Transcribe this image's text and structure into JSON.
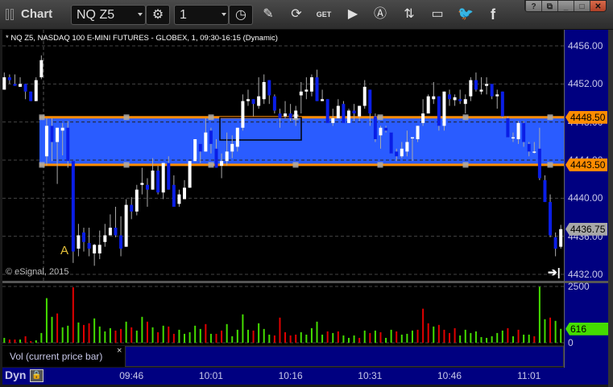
{
  "window": {
    "title": "Chart",
    "symbol": "NQ Z5",
    "interval": "1",
    "buttons": [
      "help",
      "restore-menu",
      "minimize",
      "maximize",
      "close"
    ],
    "toolbar_icons": [
      "settings-icon",
      "clock-icon",
      "pencil-icon",
      "refresh-icon",
      "get-icon",
      "play-icon",
      "alert-icon",
      "link-icon",
      "comment-icon",
      "twitter-icon",
      "facebook-icon"
    ]
  },
  "chart": {
    "info": "* NQ Z5, NASDAQ 100 E-MINI FUTURES - GLOBEX, 1, 09:30-16:15 (Dynamic)",
    "copyright": "© eSignal, 2015",
    "marker_label": "A",
    "price_axis": [
      "4456.00",
      "4452.00",
      "4448.00",
      "4444.00",
      "4440.00",
      "4436.00",
      "4432.00"
    ],
    "tags": [
      {
        "label": "4448.50",
        "value": 4448.5,
        "color": "#ff8c00"
      },
      {
        "label": "4443.50",
        "value": 4443.5,
        "color": "#ff8c00"
      },
      {
        "label": "4436.75",
        "value": 4436.75,
        "color": "#a8a8a8"
      }
    ],
    "zone": {
      "top": 4448.5,
      "bottom": 4443.5,
      "fill": "#2a5cff",
      "border": "#ff8c00"
    },
    "colors": {
      "up": "#ffffff",
      "down": "#0a1ee6",
      "vol_up": "#44dd00",
      "vol_down": "#e00000",
      "axis": "#000080"
    }
  },
  "volume": {
    "axis": [
      "2500",
      "0"
    ],
    "current_label": "616",
    "study_label": "Vol (current price bar)",
    "close": "×"
  },
  "time_axis": {
    "mode": "Dyn",
    "labels": [
      "09:46",
      "10:01",
      "10:16",
      "10:31",
      "10:46",
      "11:01"
    ]
  },
  "chart_data": {
    "type": "candlestick",
    "ylim": [
      4432,
      4456
    ],
    "ohlc": [
      [
        4451.4,
        4453.2,
        4451.4,
        4452.7
      ],
      [
        4452.7,
        4453.0,
        4452.0,
        4452.4
      ],
      [
        4452.0,
        4453.0,
        4451.8,
        4451.8
      ],
      [
        4451.7,
        4452.7,
        4451.7,
        4452.0
      ],
      [
        4452.0,
        4452.0,
        4450.4,
        4451.2
      ],
      [
        4451.2,
        4451.2,
        4450.2,
        4450.2
      ],
      [
        4450.2,
        4452.7,
        4450.2,
        4452.4
      ],
      [
        4452.7,
        4455.0,
        4452.5,
        4454.5
      ],
      [
        4444.4,
        4448.4,
        4443.4,
        4447.6
      ],
      [
        4447.6,
        4448.4,
        4443.9,
        4445.9
      ],
      [
        4445.9,
        4447.4,
        4441.5,
        4447.4
      ],
      [
        4447.1,
        4447.9,
        4444.5,
        4447.4
      ],
      [
        4447.4,
        4448.1,
        4443.2,
        4443.9
      ],
      [
        4443.9,
        4443.9,
        4433.2,
        4434.4
      ],
      [
        4434.7,
        4437.3,
        4433.9,
        4436.1
      ],
      [
        4436.4,
        4436.9,
        4434.4,
        4435.4
      ],
      [
        4435.3,
        4436.9,
        4433.9,
        4434.7
      ],
      [
        4434.2,
        4435.2,
        4432.9,
        4435.1
      ],
      [
        4434.2,
        4436.6,
        4433.6,
        4435.1
      ],
      [
        4435.4,
        4437.3,
        4434.9,
        4436.1
      ],
      [
        4436.1,
        4438.3,
        4436.1,
        4436.9
      ],
      [
        4436.9,
        4439.1,
        4435.9,
        4436.1
      ],
      [
        4436.1,
        4438.1,
        4433.9,
        4434.7
      ],
      [
        4434.9,
        4439.9,
        4434.9,
        4439.3
      ],
      [
        4439.3,
        4440.1,
        4437.8,
        4438.6
      ],
      [
        4438.6,
        4441.4,
        4438.2,
        4440.9
      ],
      [
        4441.4,
        4443.2,
        4440.4,
        4441.6
      ],
      [
        4441.4,
        4442.1,
        4439.1,
        4440.9
      ],
      [
        4440.9,
        4444.2,
        4440.9,
        4442.9
      ],
      [
        4442.9,
        4443.4,
        4440.4,
        4440.6
      ],
      [
        4440.6,
        4443.7,
        4439.9,
        4443.7
      ],
      [
        4443.7,
        4444.4,
        4440.9,
        4440.9
      ],
      [
        4441.4,
        4442.4,
        4439.1,
        4439.1
      ],
      [
        4439.4,
        4440.9,
        4439.1,
        4440.4
      ],
      [
        4439.9,
        4441.9,
        4439.9,
        4441.1
      ],
      [
        4441.1,
        4443.9,
        4441.1,
        4443.9
      ],
      [
        4443.9,
        4446.2,
        4443.9,
        4446.2
      ],
      [
        4445.7,
        4445.7,
        4443.7,
        4444.9
      ],
      [
        4444.9,
        4448.4,
        4444.9,
        4446.9
      ],
      [
        4447.1,
        4447.4,
        4444.7,
        4445.7
      ],
      [
        4445.2,
        4446.2,
        4443.2,
        4443.2
      ],
      [
        4443.4,
        4444.7,
        4442.1,
        4443.9
      ],
      [
        4443.9,
        4446.9,
        4443.4,
        4444.9
      ],
      [
        4444.9,
        4446.6,
        4444.2,
        4445.7
      ],
      [
        4445.4,
        4447.4,
        4444.9,
        4447.4
      ],
      [
        4447.4,
        4450.9,
        4447.1,
        4450.2
      ],
      [
        4450.2,
        4451.4,
        4449.7,
        4450.4
      ],
      [
        4450.4,
        4450.4,
        4448.6,
        4449.9
      ],
      [
        4449.7,
        4452.7,
        4449.4,
        4450.7
      ],
      [
        4450.4,
        4453.0,
        4449.9,
        4452.2
      ],
      [
        4452.4,
        4452.4,
        4449.9,
        4450.8
      ],
      [
        4450.7,
        4450.9,
        4448.9,
        4449.2
      ],
      [
        4448.9,
        4449.4,
        4447.4,
        4448.4
      ],
      [
        4448.6,
        4450.2,
        4448.4,
        4448.9
      ],
      [
        4448.9,
        4449.9,
        4448.1,
        4448.4
      ],
      [
        4448.4,
        4449.7,
        4447.6,
        4449.2
      ],
      [
        4450.8,
        4452.2,
        4448.9,
        4451.2
      ],
      [
        4451.2,
        4452.7,
        4450.4,
        4451.4
      ],
      [
        4451.2,
        4453.0,
        4450.7,
        4452.7
      ],
      [
        4452.7,
        4453.5,
        4450.2,
        4450.2
      ],
      [
        4450.2,
        4451.4,
        4450.2,
        4450.4
      ],
      [
        4450.4,
        4450.4,
        4447.9,
        4447.9
      ],
      [
        4447.9,
        4449.4,
        4447.6,
        4448.4
      ],
      [
        4448.4,
        4450.4,
        4448.4,
        4449.7
      ],
      [
        4449.9,
        4450.2,
        4447.9,
        4447.9
      ],
      [
        4447.9,
        4449.4,
        4447.9,
        4449.2
      ],
      [
        4449.2,
        4449.9,
        4448.1,
        4448.9
      ],
      [
        4448.6,
        4449.7,
        4448.1,
        4449.7
      ],
      [
        4449.7,
        4452.4,
        4449.4,
        4451.7
      ],
      [
        4451.4,
        4451.4,
        4447.6,
        4448.9
      ],
      [
        4448.6,
        4448.9,
        4445.9,
        4446.2
      ],
      [
        4446.6,
        4447.6,
        4445.2,
        4447.4
      ],
      [
        4447.4,
        4447.6,
        4446.9,
        4447.1
      ],
      [
        4446.9,
        4446.9,
        4444.7,
        4444.7
      ],
      [
        4444.9,
        4445.2,
        4443.9,
        4444.4
      ],
      [
        4444.4,
        4445.9,
        4444.2,
        4445.2
      ],
      [
        4444.9,
        4447.1,
        4444.4,
        4445.9
      ],
      [
        4446.3,
        4446.4,
        4443.9,
        4446.4
      ],
      [
        4446.2,
        4447.6,
        4445.9,
        4447.6
      ],
      [
        4447.9,
        4450.4,
        4447.6,
        4448.9
      ],
      [
        4448.9,
        4450.9,
        4448.9,
        4450.7
      ],
      [
        4450.4,
        4452.2,
        4449.9,
        4450.7
      ],
      [
        4450.7,
        4450.7,
        4447.1,
        4447.6
      ],
      [
        4447.6,
        4451.2,
        4447.1,
        4451.2
      ],
      [
        4450.9,
        4451.4,
        4449.7,
        4450.4
      ],
      [
        4450.3,
        4450.9,
        4449.7,
        4450.6
      ],
      [
        4450.4,
        4451.4,
        4449.9,
        4450.2
      ],
      [
        4449.9,
        4450.9,
        4448.9,
        4450.4
      ],
      [
        4450.7,
        4452.7,
        4450.2,
        4452.4
      ],
      [
        4452.4,
        4453.2,
        4451.2,
        4451.4
      ],
      [
        4451.2,
        4452.7,
        4450.9,
        4451.4
      ],
      [
        4451.8,
        4452.7,
        4450.9,
        4452.0
      ],
      [
        4452.0,
        4452.0,
        4450.4,
        4450.7
      ],
      [
        4450.7,
        4451.4,
        4449.4,
        4450.9
      ],
      [
        4451.2,
        4451.2,
        4448.4,
        4448.6
      ],
      [
        4448.4,
        4448.6,
        4446.4,
        4446.4
      ],
      [
        4446.3,
        4446.9,
        4445.9,
        4446.4
      ],
      [
        4446.2,
        4448.1,
        4445.7,
        4447.9
      ],
      [
        4447.9,
        4448.1,
        4445.4,
        4445.9
      ],
      [
        4445.7,
        4445.9,
        4444.4,
        4444.9
      ],
      [
        4444.8,
        4445.9,
        4444.7,
        4444.9
      ],
      [
        4445.2,
        4447.4,
        4441.9,
        4442.1
      ],
      [
        4441.9,
        4442.4,
        4439.6,
        4439.6
      ],
      [
        4439.6,
        4440.4,
        4435.9,
        4436.1
      ],
      [
        4435.9,
        4436.4,
        4433.9,
        4434.7
      ],
      [
        4434.9,
        4437.2,
        4434.7,
        4436.75
      ]
    ],
    "volume": [
      216,
      144,
      144,
      144,
      288,
      72,
      108,
      432,
      1980,
      1150,
      1300,
      684,
      756,
      2460,
      900,
      790,
      864,
      1080,
      720,
      504,
      648,
      540,
      612,
      936,
      684,
      540,
      1150,
      936,
      684,
      468,
      756,
      720,
      396,
      576,
      396,
      468,
      756,
      612,
      828,
      396,
      396,
      540,
      828,
      288,
      576,
      1260,
      576,
      540,
      864,
      612,
      360,
      324,
      1116,
      468,
      324,
      360,
      468,
      360,
      648,
      936,
      360,
      504,
      432,
      504,
      324,
      216,
      324,
      216,
      540,
      432,
      540,
      468,
      216,
      576,
      504,
      360,
      396,
      540,
      576,
      1512,
      864,
      720,
      792,
      576,
      432,
      648,
      324,
      576,
      432,
      504,
      252,
      216,
      288,
      432,
      540,
      648,
      288,
      576,
      360,
      360,
      288,
      2484,
      1044,
      1116,
      972,
      616
    ],
    "volume_direction": "gddgddggggdggdgddggggddgdggdgdgddgggggdgddgggggdgggddd ddgggggdgdgggdgdgdggdgggdddgddddgggggggggdgdggdggdggdgdgdgddggddgddddg",
    "volume_ylim": [
      0,
      2500
    ],
    "x_ticks": [
      "09:46",
      "10:01",
      "10:16",
      "10:31",
      "10:46",
      "11:01"
    ]
  }
}
